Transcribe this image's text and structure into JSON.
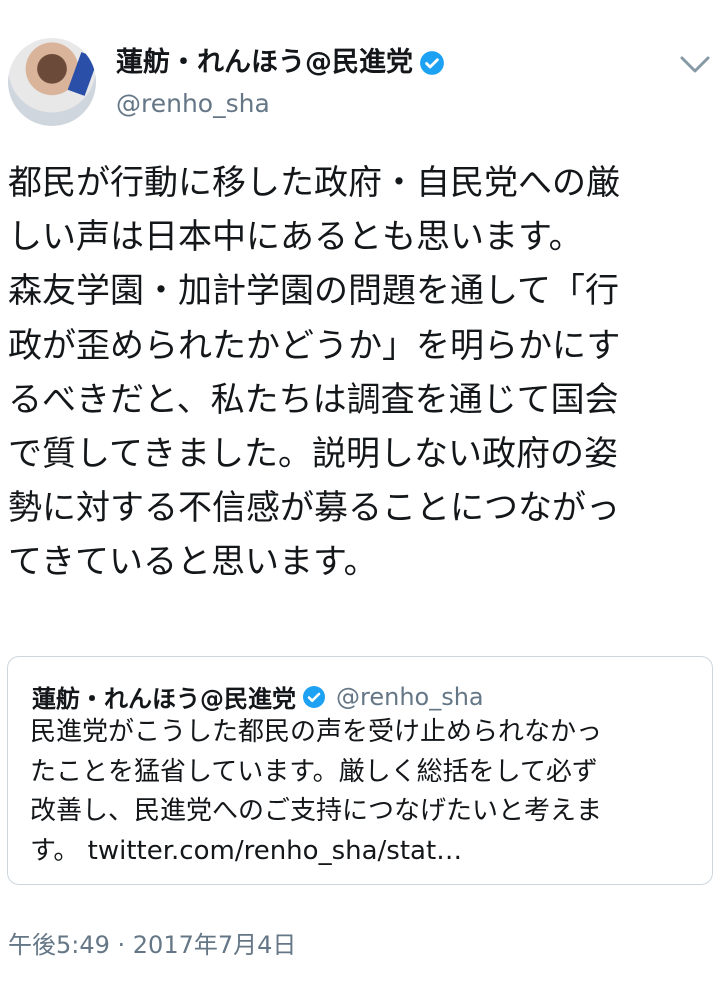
{
  "author": {
    "display_name": "蓮舫・れんほう@民進党",
    "handle": "@renho_sha",
    "avatar_icon": "profile-photo",
    "verified_icon": "verified-badge-icon"
  },
  "tweet": {
    "lines": [
      "都民が行動に移した政府・自民党への厳",
      "しい声は日本中にあるとも思います。",
      "森友学園・加計学園の問題を通して「行",
      "政が歪められたかどうか」を明らかにす",
      "るべきだと、私たちは調査を通じて国会",
      "で質してきました。説明しない政府の姿",
      "勢に対する不信感が募ることにつながっ",
      "てきていると思います。"
    ]
  },
  "quoted_tweet": {
    "display_name": "蓮舫・れんほう@民進党",
    "handle": "@renho_sha",
    "lines": [
      "民進党がこうした都民の声を受け止められなかっ",
      "たことを猛省しています。厳しく総括をして必ず",
      "改善し、民進党へのご支持につなげたいと考えま",
      "す。 twitter.com/renho_sha/stat…"
    ]
  },
  "timestamp": "午後5:49 · 2017年7月4日",
  "colors": {
    "verified": "#1da1f2",
    "secondary_text": "#657786",
    "border": "#ccd6dd"
  }
}
